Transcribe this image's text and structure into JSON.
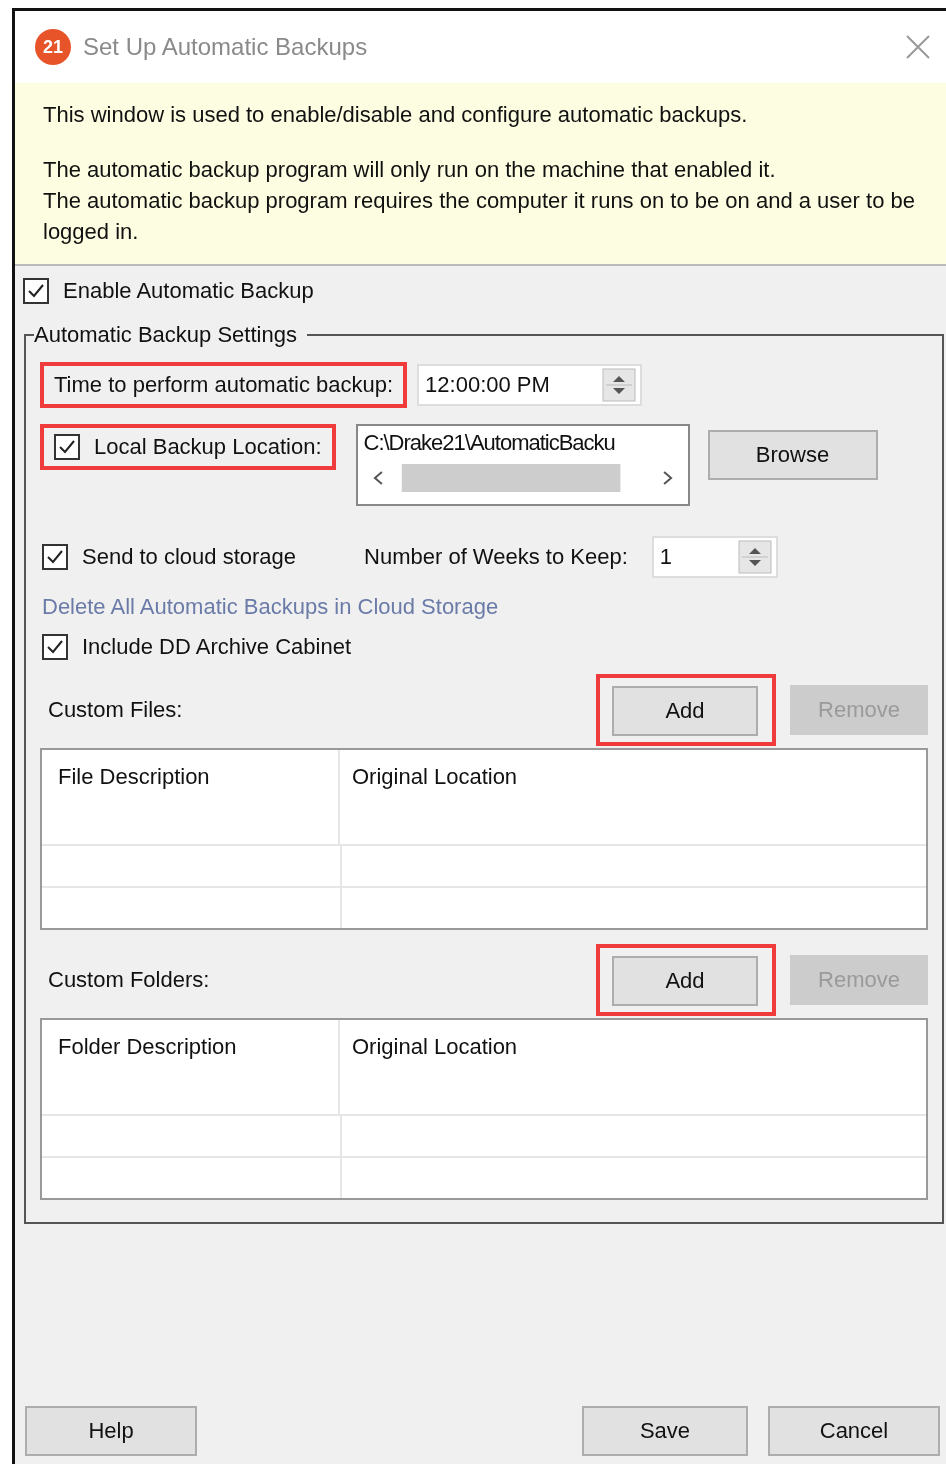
{
  "window": {
    "icon_label": "21",
    "title": "Set Up Automatic Backups"
  },
  "info_paragraphs": [
    [
      "This window is used to enable/disable and configure automatic backups."
    ],
    [
      "The automatic backup program will only run on the machine that enabled it.",
      "The automatic backup program requires the computer it runs on to be on and a user to be logged in."
    ]
  ],
  "enable_automatic_backup": {
    "label": "Enable Automatic Backup",
    "checked": true
  },
  "settings": {
    "legend": "Automatic Backup Settings",
    "time": {
      "label": "Time to perform automatic backup:",
      "value": "12:00:00 PM",
      "highlighted": true
    },
    "local_backup": {
      "label": "Local Backup Location:",
      "checked": true,
      "highlighted": true,
      "path": "C:\\Drake21\\AutomaticBacku",
      "browse_button": "Browse"
    },
    "cloud": {
      "label": "Send to cloud storage",
      "checked": true,
      "weeks_label": "Number of Weeks to Keep:",
      "weeks_value": "1"
    },
    "delete_link": "Delete All Automatic Backups in Cloud Storage",
    "include_dd": {
      "label": "Include DD Archive Cabinet",
      "checked": true
    },
    "lists": [
      {
        "label": "Custom Files:",
        "buttons": [
          {
            "label": "Add",
            "disabled": false,
            "highlighted": true
          },
          {
            "label": "Remove",
            "disabled": true,
            "highlighted": false
          }
        ],
        "columns": [
          "File Description",
          "Original Location"
        ]
      },
      {
        "label": "Custom Folders:",
        "buttons": [
          {
            "label": "Add",
            "disabled": false,
            "highlighted": true
          },
          {
            "label": "Remove",
            "disabled": true,
            "highlighted": false
          }
        ],
        "columns": [
          "Folder Description",
          "Original Location"
        ]
      }
    ]
  },
  "footer": {
    "left": [
      "Help"
    ],
    "right": [
      "Save",
      "Cancel"
    ]
  }
}
